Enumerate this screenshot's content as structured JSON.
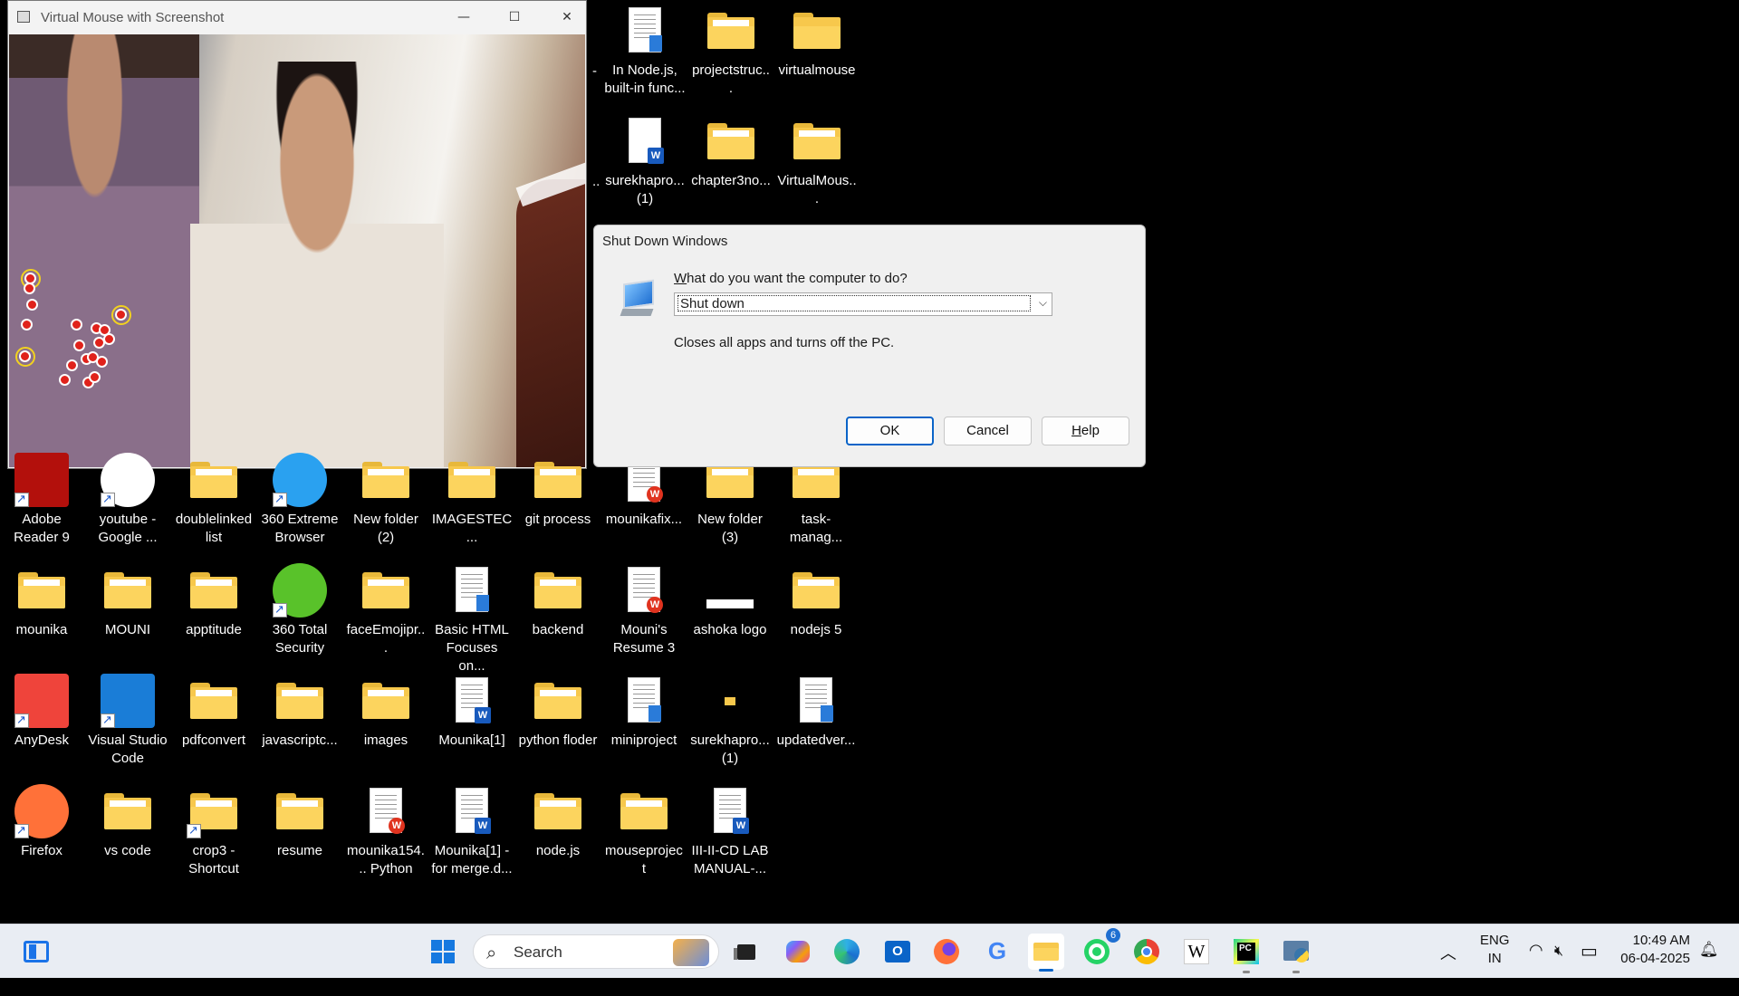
{
  "camera_window": {
    "title": "Virtual Mouse with Screenshot",
    "minimize_glyph": "—",
    "maximize_glyph": "☐",
    "close_glyph": "✕"
  },
  "dialog": {
    "title": "Shut Down Windows",
    "question_first": "W",
    "question_rest": "hat do you want the computer to do?",
    "selected_action": "Shut down",
    "description": "Closes all apps and turns off the PC.",
    "ok_label": "OK",
    "cancel_label": "Cancel",
    "help_label_first": "H",
    "help_label_rest": "elp"
  },
  "desktop": {
    "top_icons": [
      {
        "label": "In Node.js, built-in func...",
        "kind": "text-doc"
      },
      {
        "label": "projectstruc...",
        "kind": "folder"
      },
      {
        "label": "virtualmouse",
        "kind": "folder"
      },
      {
        "label": "surekhapro... (1)",
        "kind": "word-doc"
      },
      {
        "label": "chapter3no...",
        "kind": "folder"
      },
      {
        "label": "VirtualMous...",
        "kind": "folder"
      }
    ],
    "top_icons_dash": "-",
    "top_icons_dots": "..",
    "row1": [
      {
        "label": "Adobe Reader 9",
        "kind": "app"
      },
      {
        "label": "youtube - Google ...",
        "kind": "app"
      },
      {
        "label": "doublelinked list",
        "kind": "folder"
      },
      {
        "label": "360 Extreme Browser",
        "kind": "app"
      },
      {
        "label": "New folder (2)",
        "kind": "folder"
      },
      {
        "label": "IMAGESTEC...",
        "kind": "folder"
      },
      {
        "label": "git process",
        "kind": "folder"
      },
      {
        "label": "mounikafix...",
        "kind": "wps-doc"
      },
      {
        "label": "New folder (3)",
        "kind": "folder"
      },
      {
        "label": "task-manag...",
        "kind": "folder"
      }
    ],
    "row2": [
      {
        "label": "mounika",
        "kind": "folder"
      },
      {
        "label": "MOUNI",
        "kind": "folder"
      },
      {
        "label": "apptitude",
        "kind": "folder"
      },
      {
        "label": "360 Total Security",
        "kind": "app"
      },
      {
        "label": "faceEmojipr...",
        "kind": "folder"
      },
      {
        "label": "Basic HTML Focuses on...",
        "kind": "text-doc"
      },
      {
        "label": "backend",
        "kind": "folder"
      },
      {
        "label": "Mouni's Resume 3",
        "kind": "wps-doc"
      },
      {
        "label": "ashoka logo",
        "kind": "image"
      },
      {
        "label": "nodejs 5",
        "kind": "folder"
      }
    ],
    "row3": [
      {
        "label": "AnyDesk",
        "kind": "app"
      },
      {
        "label": "Visual Studio Code",
        "kind": "app"
      },
      {
        "label": "pdfconvert",
        "kind": "folder"
      },
      {
        "label": "javascriptc...",
        "kind": "folder"
      },
      {
        "label": "images",
        "kind": "folder"
      },
      {
        "label": "Mounika[1]",
        "kind": "word-doc"
      },
      {
        "label": "python floder",
        "kind": "folder"
      },
      {
        "label": "miniproject",
        "kind": "text-doc"
      },
      {
        "label": "surekhapro... (1)",
        "kind": "small-folder"
      },
      {
        "label": "updatedver...",
        "kind": "text-doc"
      }
    ],
    "row4": [
      {
        "label": "Firefox",
        "kind": "app"
      },
      {
        "label": "vs code",
        "kind": "folder"
      },
      {
        "label": "crop3 - Shortcut",
        "kind": "folder"
      },
      {
        "label": "resume",
        "kind": "folder"
      },
      {
        "label": "mounika154... Python",
        "kind": "wps-doc"
      },
      {
        "label": "Mounika[1] - for merge.d...",
        "kind": "word-doc"
      },
      {
        "label": "node.js",
        "kind": "folder"
      },
      {
        "label": "mouseproject",
        "kind": "folder"
      },
      {
        "label": "III-II-CD LAB MANUAL-...",
        "kind": "word-doc"
      }
    ]
  },
  "taskbar": {
    "search_placeholder": "Search",
    "whatsapp_badge": "6",
    "language_line1": "ENG",
    "language_line2": "IN",
    "time": "10:49 AM",
    "date": "06-04-2025",
    "google_glyph": "G",
    "wikipedia_glyph": "W",
    "pycharm_glyph": "PC",
    "outlook_glyph": "O",
    "chevron_glyph": "︿",
    "wifi_glyph": "◠",
    "mute_glyph": "🔇︎",
    "battery_glyph": "▭",
    "notification_glyph": "🔔︎",
    "search_glyph": "⌕"
  },
  "colors": {
    "accent": "#0a64c8",
    "taskbar_bg": "#e9edf3",
    "folder": "#f7c84c",
    "landmark_red": "#e0221b",
    "landmark_ring": "#f2d21f"
  }
}
